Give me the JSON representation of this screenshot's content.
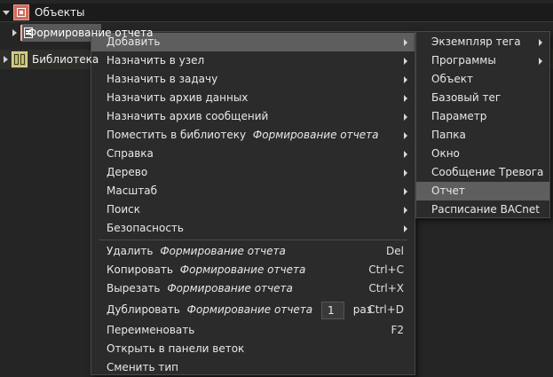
{
  "tree": {
    "objects_label": "Объекты",
    "form_label": "Формирование отчета",
    "library_label": "Библиотека"
  },
  "menu": {
    "item_ref": "Формирование отчета",
    "add": "Добавить",
    "assign_node": "Назначить в узел",
    "assign_task": "Назначить в задачу",
    "assign_data_archive": "Назначить архив данных",
    "assign_msg_archive": "Назначить архив сообщений",
    "place_library": "Поместить в библиотеку",
    "help": "Справка",
    "tree": "Дерево",
    "scale": "Масштаб",
    "search": "Поиск",
    "security": "Безопасность",
    "delete": "Удалить",
    "delete_sc": "Del",
    "copy": "Копировать",
    "copy_sc": "Ctrl+C",
    "cut": "Вырезать",
    "cut_sc": "Ctrl+X",
    "duplicate": "Дублировать",
    "duplicate_count": "1",
    "duplicate_times": "раз",
    "duplicate_sc": "Ctrl+D",
    "rename": "Переименовать",
    "rename_sc": "F2",
    "open_branch_panel": "Открыть в панели веток",
    "change_type": "Сменить тип"
  },
  "submenu": {
    "tag_instance": "Экземпляр тега",
    "programs": "Программы",
    "object": "Объект",
    "base_tag": "Базовый тег",
    "parameter": "Параметр",
    "folder": "Папка",
    "window": "Окно",
    "alarm_message": "Сообщение Тревога",
    "report": "Отчет",
    "bacnet_schedule": "Расписание BACnet"
  }
}
